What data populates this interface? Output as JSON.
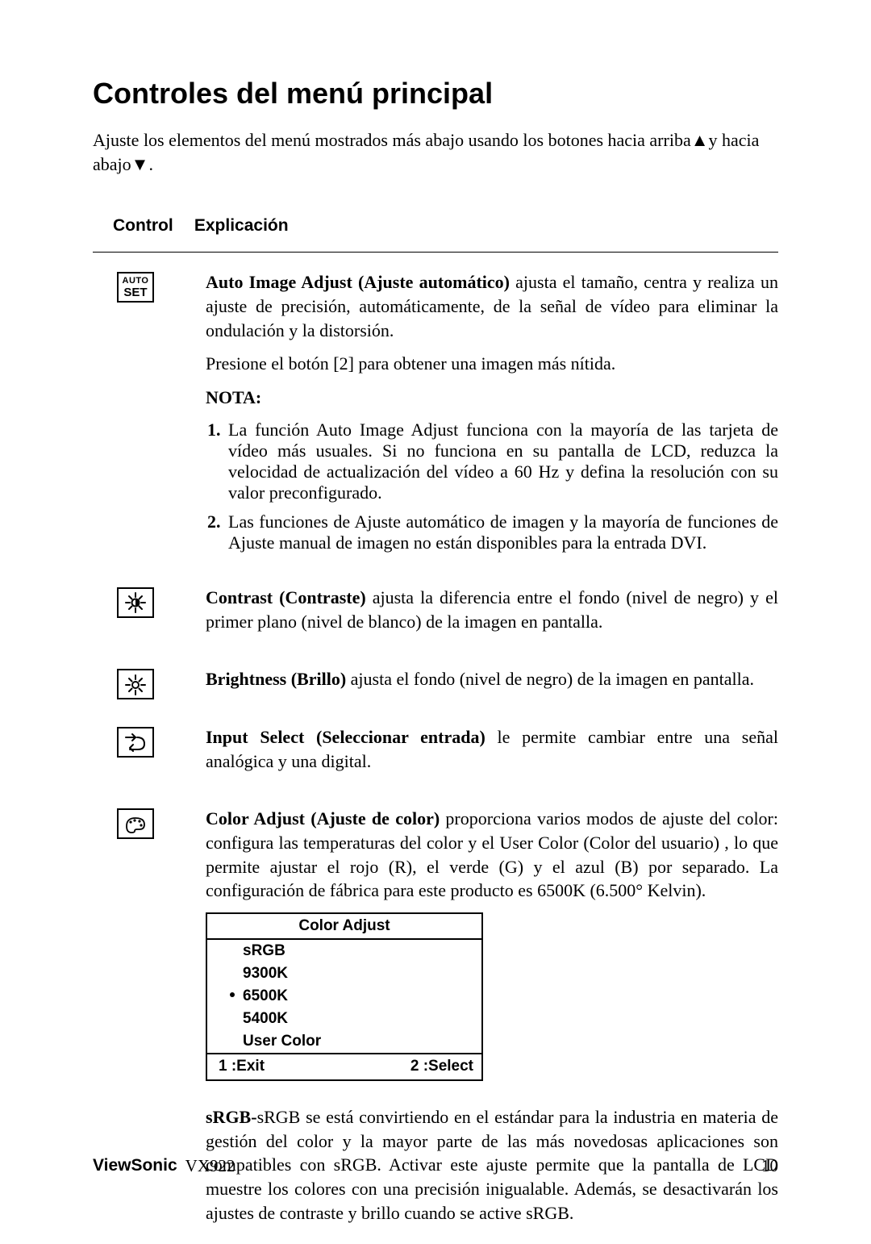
{
  "title": "Controles del menú principal",
  "intro_a": "Ajuste los elementos del menú mostrados más abajo usando los botones hacia arriba",
  "intro_b": "y hacia abajo",
  "intro_c": ".",
  "headers": {
    "control": "Control",
    "explanation": "Explicación"
  },
  "auto": {
    "icon_l1": "AUTO",
    "icon_l2": "SET",
    "title": "Auto Image Adjust (Ajuste automático)",
    "body": " ajusta el tamaño, centra y realiza un ajuste de precisión, automáticamente, de la señal de vídeo para eliminar la ondulación y la distorsión.",
    "press": "Presione el botón [2] para obtener una imagen más nítida.",
    "nota_label": "NOTA:",
    "note1": "La función Auto Image Adjust funciona con la mayoría de las tarjeta de vídeo más usuales. Si no funciona en su pantalla de LCD, reduzca la velocidad de actualización del vídeo a 60 Hz y defina la resolución con su valor preconfigurado.",
    "note2": "Las funciones de Ajuste automático de imagen y la mayoría de funciones de Ajuste manual de imagen no están disponibles para la entrada DVI."
  },
  "contrast": {
    "title": "Contrast (Contraste)",
    "body": " ajusta la diferencia entre el fondo (nivel de negro) y el primer plano (nivel de blanco) de la imagen en pantalla."
  },
  "brightness": {
    "title": "Brightness (Brillo)",
    "body": " ajusta el fondo (nivel de negro) de la imagen en pantalla."
  },
  "input": {
    "title": "Input Select (Seleccionar entrada)",
    "body": " le permite cambiar entre una señal analógica y una digital."
  },
  "color": {
    "title": "Color Adjust (Ajuste de color)",
    "body": " proporciona varios modos de ajuste del color: configura las temperaturas del color y el User Color (Color del usuario) ,  lo que permite ajustar el rojo (R), el verde (G) y el azul (B) por separado. La configuración de fábrica para este producto es 6500K (6.500° Kelvin)."
  },
  "osd": {
    "title": "Color Adjust",
    "items": [
      "sRGB",
      "9300K",
      "6500K",
      "5400K",
      "User Color"
    ],
    "selected_index": 2,
    "exit": "1 :Exit",
    "select": "2 :Select"
  },
  "srgb": {
    "title": "sRGB-",
    "body": "sRGB se está convirtiendo en el estándar para la industria en materia de gestión del color y la mayor parte de las más novedosas aplicaciones son compatibles con sRGB. Activar este ajuste permite que la pantalla de LCD muestre los colores con una precisión inigualable. Además, se desactivarán los ajustes de contraste y brillo cuando se active sRGB."
  },
  "footer": {
    "brand": "ViewSonic",
    "model": "VX922",
    "page": "10"
  }
}
